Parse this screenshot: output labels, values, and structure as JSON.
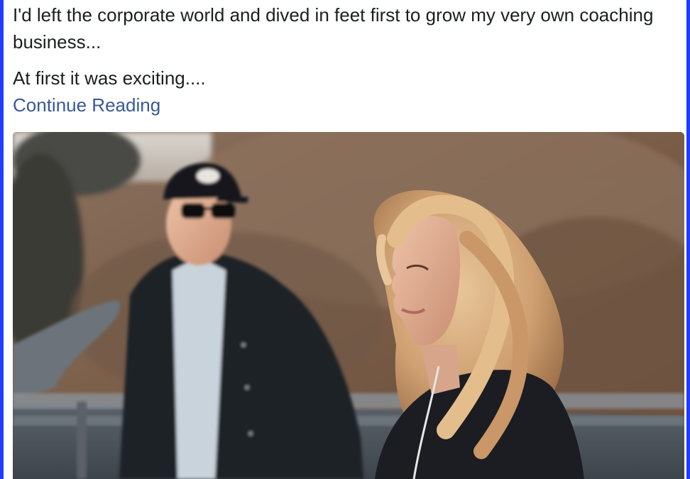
{
  "post": {
    "paragraph_1": "I'd left the corporate world and dived in feet first to grow my very own coaching business...",
    "paragraph_2": "At first it was exciting....",
    "link_label": "Continue Reading"
  },
  "colors": {
    "frame_border": "#1f3cff",
    "text": "#1c1e21",
    "link": "#385898"
  },
  "image": {
    "subject": "man-in-cap-and-woman-with-blonde-hair-photo"
  }
}
